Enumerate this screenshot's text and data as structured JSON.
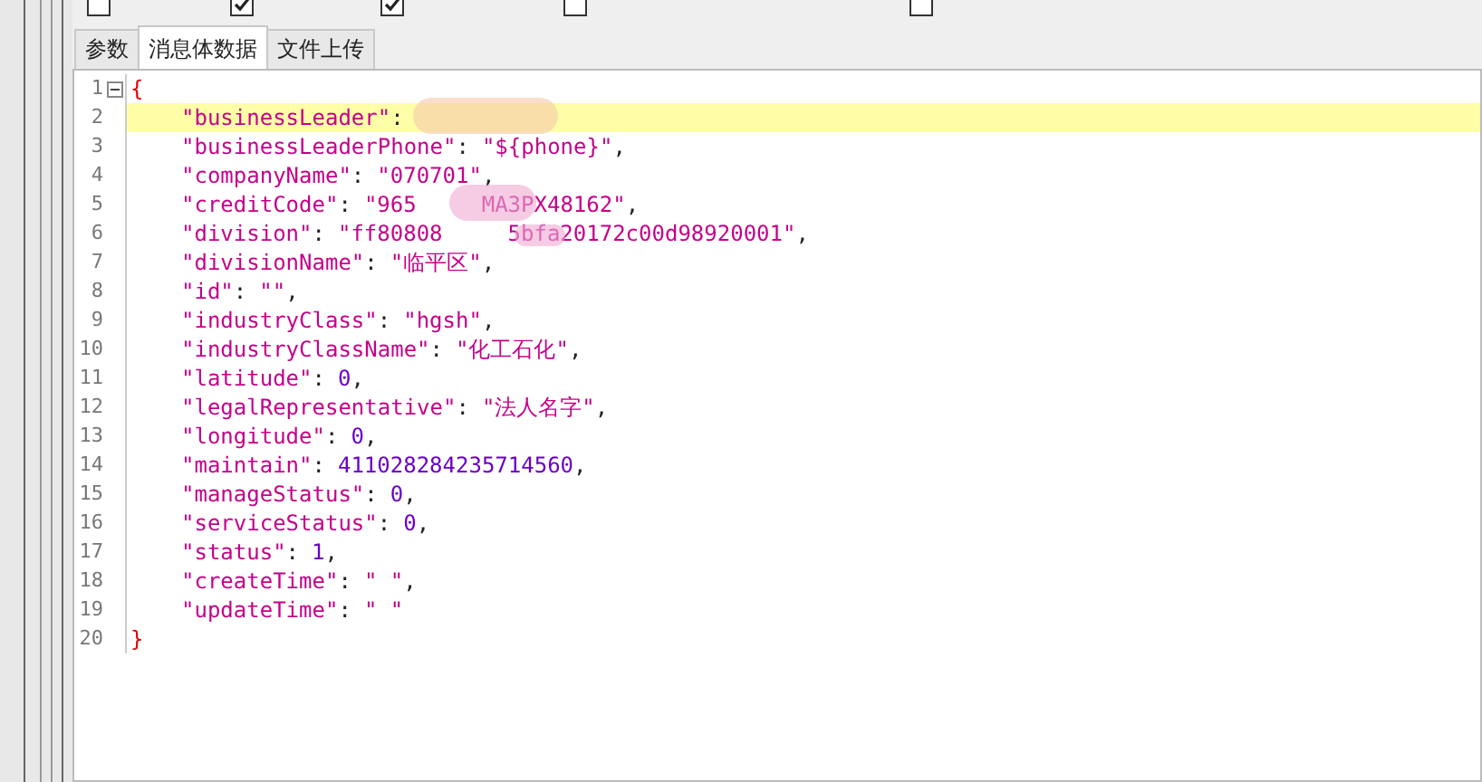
{
  "options": [
    {
      "checked": false
    },
    {
      "checked": true
    },
    {
      "checked": true
    },
    {
      "checked": false
    },
    {
      "checked": false
    }
  ],
  "tabs": [
    {
      "label": "参数",
      "selected": false
    },
    {
      "label": "消息体数据",
      "selected": true
    },
    {
      "label": "文件上传",
      "selected": false
    }
  ],
  "editor": {
    "lines": [
      {
        "number": "1",
        "foldable": true,
        "current": false,
        "blurred": false,
        "tokens": [
          {
            "kind": "brace",
            "text": "{"
          }
        ]
      },
      {
        "number": "2",
        "foldable": false,
        "current": true,
        "blurred": true,
        "tokens": [
          {
            "kind": "key",
            "text": "\"businessLeader\""
          },
          {
            "kind": "colon",
            "text": ":"
          }
        ]
      },
      {
        "number": "3",
        "foldable": false,
        "current": false,
        "blurred": false,
        "tokens": [
          {
            "kind": "key",
            "text": "\"businessLeaderPhone\""
          },
          {
            "kind": "colon",
            "text": ":"
          },
          {
            "kind": "string",
            "text": "\"${phone}\""
          },
          {
            "kind": "comma",
            "text": ","
          }
        ]
      },
      {
        "number": "4",
        "foldable": false,
        "current": false,
        "blurred": false,
        "tokens": [
          {
            "kind": "key",
            "text": "\"companyName\""
          },
          {
            "kind": "colon",
            "text": ":"
          },
          {
            "kind": "string",
            "text": "\"070701\""
          },
          {
            "kind": "comma",
            "text": ","
          }
        ]
      },
      {
        "number": "5",
        "foldable": false,
        "current": false,
        "blurred": true,
        "tokens": [
          {
            "kind": "key",
            "text": "\"creditCode\""
          },
          {
            "kind": "colon",
            "text": ":"
          },
          {
            "kind": "string",
            "text": "\"965"
          },
          {
            "kind": "gap",
            "text": "MA3PX48162\""
          },
          {
            "kind": "comma",
            "text": ","
          }
        ]
      },
      {
        "number": "6",
        "foldable": false,
        "current": false,
        "blurred": true,
        "tokens": [
          {
            "kind": "key",
            "text": "\"division\""
          },
          {
            "kind": "colon",
            "text": ":"
          },
          {
            "kind": "string",
            "text": "\"ff80808"
          },
          {
            "kind": "gap",
            "text": "5bfa20172c00d98920001\""
          },
          {
            "kind": "comma",
            "text": ","
          }
        ]
      },
      {
        "number": "7",
        "foldable": false,
        "current": false,
        "blurred": false,
        "tokens": [
          {
            "kind": "key",
            "text": "\"divisionName\""
          },
          {
            "kind": "colon",
            "text": ":"
          },
          {
            "kind": "string",
            "text": "\"临平区\""
          },
          {
            "kind": "comma",
            "text": ","
          }
        ]
      },
      {
        "number": "8",
        "foldable": false,
        "current": false,
        "blurred": false,
        "tokens": [
          {
            "kind": "key",
            "text": "\"id\""
          },
          {
            "kind": "colon",
            "text": ":"
          },
          {
            "kind": "string",
            "text": "\"\""
          },
          {
            "kind": "comma",
            "text": ","
          }
        ]
      },
      {
        "number": "9",
        "foldable": false,
        "current": false,
        "blurred": false,
        "tokens": [
          {
            "kind": "key",
            "text": "\"industryClass\""
          },
          {
            "kind": "colon",
            "text": ":"
          },
          {
            "kind": "string",
            "text": "\"hgsh\""
          },
          {
            "kind": "comma",
            "text": ","
          }
        ]
      },
      {
        "number": "10",
        "foldable": false,
        "current": false,
        "blurred": false,
        "tokens": [
          {
            "kind": "key",
            "text": "\"industryClassName\""
          },
          {
            "kind": "colon",
            "text": ":"
          },
          {
            "kind": "string",
            "text": "\"化工石化\""
          },
          {
            "kind": "comma",
            "text": ","
          }
        ]
      },
      {
        "number": "11",
        "foldable": false,
        "current": false,
        "blurred": false,
        "tokens": [
          {
            "kind": "key",
            "text": "\"latitude\""
          },
          {
            "kind": "colon",
            "text": ":"
          },
          {
            "kind": "number",
            "text": "0"
          },
          {
            "kind": "comma",
            "text": ","
          }
        ]
      },
      {
        "number": "12",
        "foldable": false,
        "current": false,
        "blurred": false,
        "tokens": [
          {
            "kind": "key",
            "text": "\"legalRepresentative\""
          },
          {
            "kind": "colon",
            "text": ":"
          },
          {
            "kind": "string",
            "text": "\"法人名字\""
          },
          {
            "kind": "comma",
            "text": ","
          }
        ]
      },
      {
        "number": "13",
        "foldable": false,
        "current": false,
        "blurred": false,
        "tokens": [
          {
            "kind": "key",
            "text": "\"longitude\""
          },
          {
            "kind": "colon",
            "text": ":"
          },
          {
            "kind": "number",
            "text": "0"
          },
          {
            "kind": "comma",
            "text": ","
          }
        ]
      },
      {
        "number": "14",
        "foldable": false,
        "current": false,
        "blurred": false,
        "tokens": [
          {
            "kind": "key",
            "text": "\"maintain\""
          },
          {
            "kind": "colon",
            "text": ":"
          },
          {
            "kind": "number",
            "text": "411028284235714560"
          },
          {
            "kind": "comma",
            "text": ","
          }
        ]
      },
      {
        "number": "15",
        "foldable": false,
        "current": false,
        "blurred": false,
        "tokens": [
          {
            "kind": "key",
            "text": "\"manageStatus\""
          },
          {
            "kind": "colon",
            "text": ":"
          },
          {
            "kind": "number",
            "text": "0"
          },
          {
            "kind": "comma",
            "text": ","
          }
        ]
      },
      {
        "number": "16",
        "foldable": false,
        "current": false,
        "blurred": false,
        "tokens": [
          {
            "kind": "key",
            "text": "\"serviceStatus\""
          },
          {
            "kind": "colon",
            "text": ":"
          },
          {
            "kind": "number",
            "text": "0"
          },
          {
            "kind": "comma",
            "text": ","
          }
        ]
      },
      {
        "number": "17",
        "foldable": false,
        "current": false,
        "blurred": false,
        "tokens": [
          {
            "kind": "key",
            "text": "\"status\""
          },
          {
            "kind": "colon",
            "text": ":"
          },
          {
            "kind": "number",
            "text": "1"
          },
          {
            "kind": "comma",
            "text": ","
          }
        ]
      },
      {
        "number": "18",
        "foldable": false,
        "current": false,
        "blurred": false,
        "tokens": [
          {
            "kind": "key",
            "text": "\"createTime\""
          },
          {
            "kind": "colon",
            "text": ":"
          },
          {
            "kind": "string",
            "text": "\" \""
          },
          {
            "kind": "comma",
            "text": ","
          }
        ]
      },
      {
        "number": "19",
        "foldable": false,
        "current": false,
        "blurred": false,
        "tokens": [
          {
            "kind": "key",
            "text": "\"updateTime\""
          },
          {
            "kind": "colon",
            "text": ":"
          },
          {
            "kind": "string",
            "text": "\" \""
          }
        ]
      },
      {
        "number": "20",
        "foldable": false,
        "current": false,
        "blurred": false,
        "tokens": [
          {
            "kind": "brace",
            "text": "}"
          }
        ]
      }
    ]
  }
}
